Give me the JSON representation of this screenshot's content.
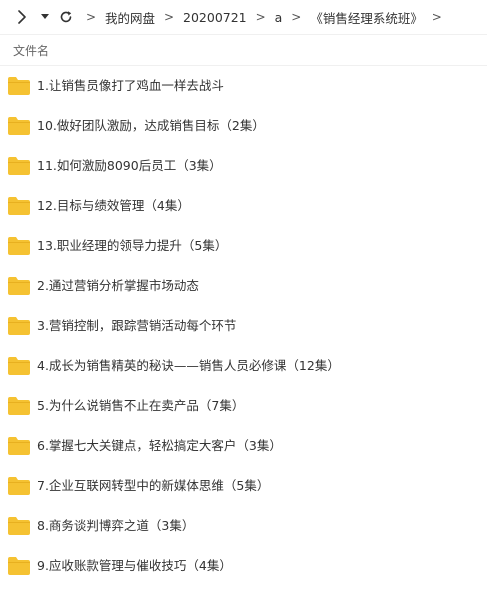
{
  "toolbar": {
    "forward_icon": "chevron-right-icon",
    "dropdown_icon": "caret-down-icon",
    "refresh_icon": "refresh-icon"
  },
  "breadcrumb": {
    "items": [
      "我的网盘",
      "20200721",
      "a",
      "《销售经理系统班》"
    ]
  },
  "column_header": {
    "name": "文件名"
  },
  "files": [
    {
      "name": "1.让销售员像打了鸡血一样去战斗"
    },
    {
      "name": "10.做好团队激励，达成销售目标（2集）"
    },
    {
      "name": "11.如何激励8090后员工（3集）"
    },
    {
      "name": "12.目标与绩效管理（4集）"
    },
    {
      "name": "13.职业经理的领导力提升（5集）"
    },
    {
      "name": "2.通过营销分析掌握市场动态"
    },
    {
      "name": "3.营销控制，跟踪营销活动每个环节"
    },
    {
      "name": "4.成长为销售精英的秘诀——销售人员必修课（12集）"
    },
    {
      "name": "5.为什么说销售不止在卖产品（7集）"
    },
    {
      "name": "6.掌握七大关键点，轻松搞定大客户（3集）"
    },
    {
      "name": "7.企业互联网转型中的新媒体思维（5集）"
    },
    {
      "name": "8.商务谈判博弈之道（3集）"
    },
    {
      "name": "9.应收账款管理与催收技巧（4集）"
    }
  ],
  "colors": {
    "folder_body": "#f5c232",
    "folder_tab": "#e8b020"
  }
}
